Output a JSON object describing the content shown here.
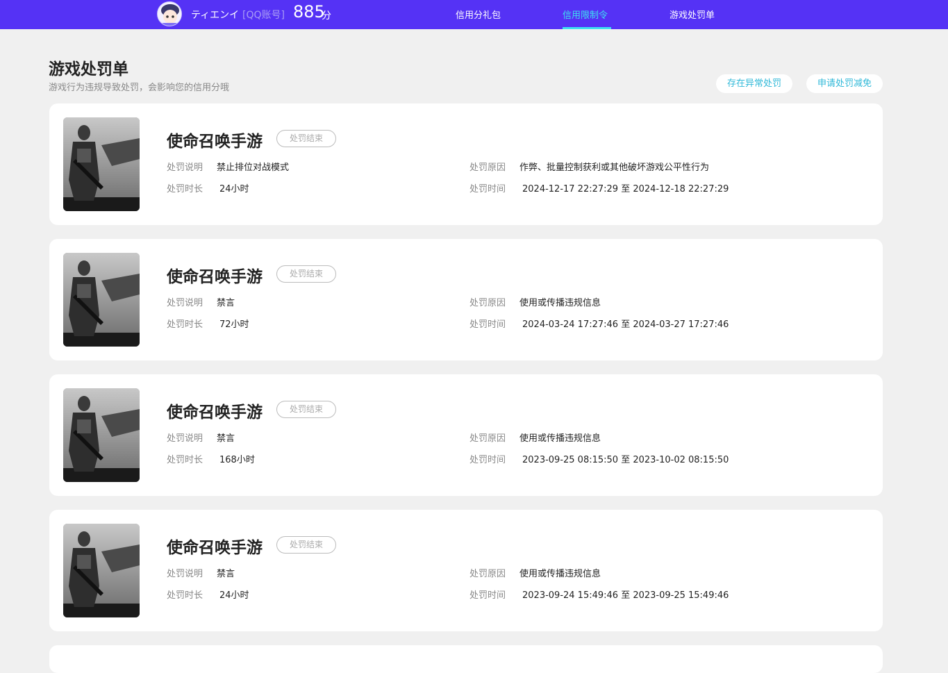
{
  "header": {
    "user_name": "ティエンイ",
    "account_type": "[QQ账号]",
    "score": "885",
    "score_unit": "分",
    "tabs": [
      {
        "label": "信用分礼包"
      },
      {
        "label": "信用限制令"
      },
      {
        "label": "游戏处罚单"
      }
    ],
    "active_tab": "信用限制令",
    "colors": {
      "bar": "#5532f5",
      "active": "#3ee0f0"
    }
  },
  "page": {
    "title": "游戏处罚单",
    "subtitle": "游戏行为违规导致处罚，会影响您的信用分哦",
    "actions": [
      {
        "label": "存在异常处罚"
      },
      {
        "label": "申请处罚减免"
      }
    ]
  },
  "field_labels": {
    "desc": "处罚说明",
    "duration": "处罚时长",
    "reason": "处罚原因",
    "time": "处罚时间"
  },
  "penalties": [
    {
      "game": "使命召唤手游",
      "status": "处罚结束",
      "desc": "禁止排位对战模式",
      "duration": "24小时",
      "reason": "作弊、批量控制获利或其他破坏游戏公平性行为",
      "time": "2024-12-17 22:27:29 至 2024-12-18 22:27:29"
    },
    {
      "game": "使命召唤手游",
      "status": "处罚结束",
      "desc": "禁言",
      "duration": "72小时",
      "reason": "使用或传播违规信息",
      "time": "2024-03-24 17:27:46 至 2024-03-27 17:27:46"
    },
    {
      "game": "使命召唤手游",
      "status": "处罚结束",
      "desc": "禁言",
      "duration": "168小时",
      "reason": "使用或传播违规信息",
      "time": "2023-09-25 08:15:50 至 2023-10-02 08:15:50"
    },
    {
      "game": "使命召唤手游",
      "status": "处罚结束",
      "desc": "禁言",
      "duration": "24小时",
      "reason": "使用或传播违规信息",
      "time": "2023-09-24 15:49:46 至 2023-09-25 15:49:46"
    }
  ]
}
